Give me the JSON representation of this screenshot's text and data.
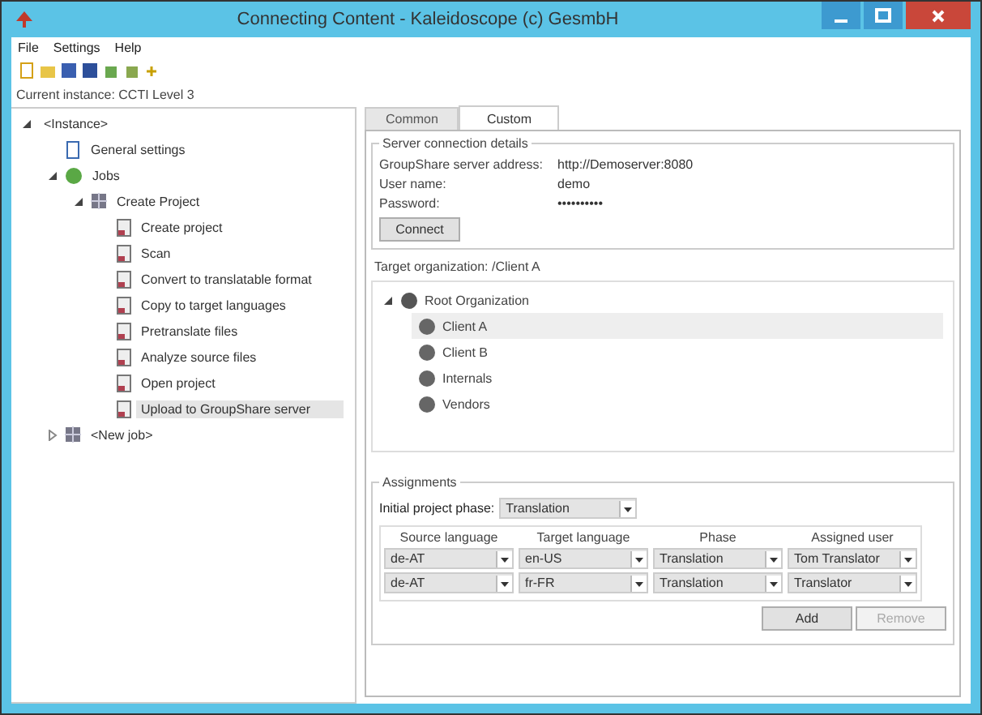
{
  "window": {
    "title": "Connecting Content - Kaleidoscope (c) GesmbH"
  },
  "menu": [
    "File",
    "Settings",
    "Help"
  ],
  "current_instance": "Current instance: CCTI Level 3",
  "tree": [
    {
      "label": "<Instance>",
      "expanded": true,
      "selected": false,
      "children": [
        {
          "label": "General settings",
          "kind": "settings",
          "selected": false
        },
        {
          "label": "Jobs",
          "kind": "jobs",
          "expanded": true,
          "selected": false,
          "children": [
            {
              "label": "Create Project",
              "kind": "project",
              "expanded": true,
              "selected": false,
              "children": [
                {
                  "label": "Create project",
                  "kind": "step",
                  "selected": false
                },
                {
                  "label": "Scan",
                  "kind": "step",
                  "selected": false
                },
                {
                  "label": "Convert to translatable format",
                  "kind": "step",
                  "selected": false
                },
                {
                  "label": "Copy to target languages",
                  "kind": "step",
                  "selected": false
                },
                {
                  "label": "Pretranslate files",
                  "kind": "step",
                  "selected": false
                },
                {
                  "label": "Analyze source files",
                  "kind": "step",
                  "selected": false
                },
                {
                  "label": "Open project",
                  "kind": "step",
                  "selected": false
                },
                {
                  "label": "Upload to GroupShare server",
                  "kind": "step",
                  "selected": true
                }
              ]
            }
          ]
        },
        {
          "label": "<New job>",
          "kind": "project",
          "expanded": false,
          "selected": false
        }
      ]
    }
  ],
  "tabs": [
    {
      "label": "Common",
      "selected": false
    },
    {
      "label": "Custom",
      "selected": true
    }
  ],
  "server": {
    "legend": "Server connection details",
    "fields": [
      {
        "label": "GroupShare server address:",
        "value": "http://Demoserver:8080"
      },
      {
        "label": "User name:",
        "value": "demo"
      },
      {
        "label": "Password:",
        "value": "••••••••••"
      }
    ],
    "connect": "Connect"
  },
  "target": "Target organization: /Client A",
  "orgs": {
    "label": "Root Organization",
    "expanded": true,
    "children": [
      {
        "label": "Client A",
        "selected": true
      },
      {
        "label": "Client B",
        "selected": false
      },
      {
        "label": "Internals",
        "selected": false
      },
      {
        "label": "Vendors",
        "selected": false
      }
    ]
  },
  "assignments": {
    "legend": "Assignments",
    "phase_label": "Initial project phase:",
    "phase": "Translation",
    "columns": [
      "Source language",
      "Target language",
      "Phase",
      "Assigned user"
    ],
    "rows": [
      [
        "de-AT",
        "en-US",
        "Translation",
        "Tom Translator"
      ],
      [
        "de-AT",
        "fr-FR",
        "Translation",
        "Translator"
      ]
    ],
    "buttons": [
      {
        "label": "Add",
        "disabled": false
      },
      {
        "label": "Remove",
        "disabled": true
      }
    ]
  }
}
